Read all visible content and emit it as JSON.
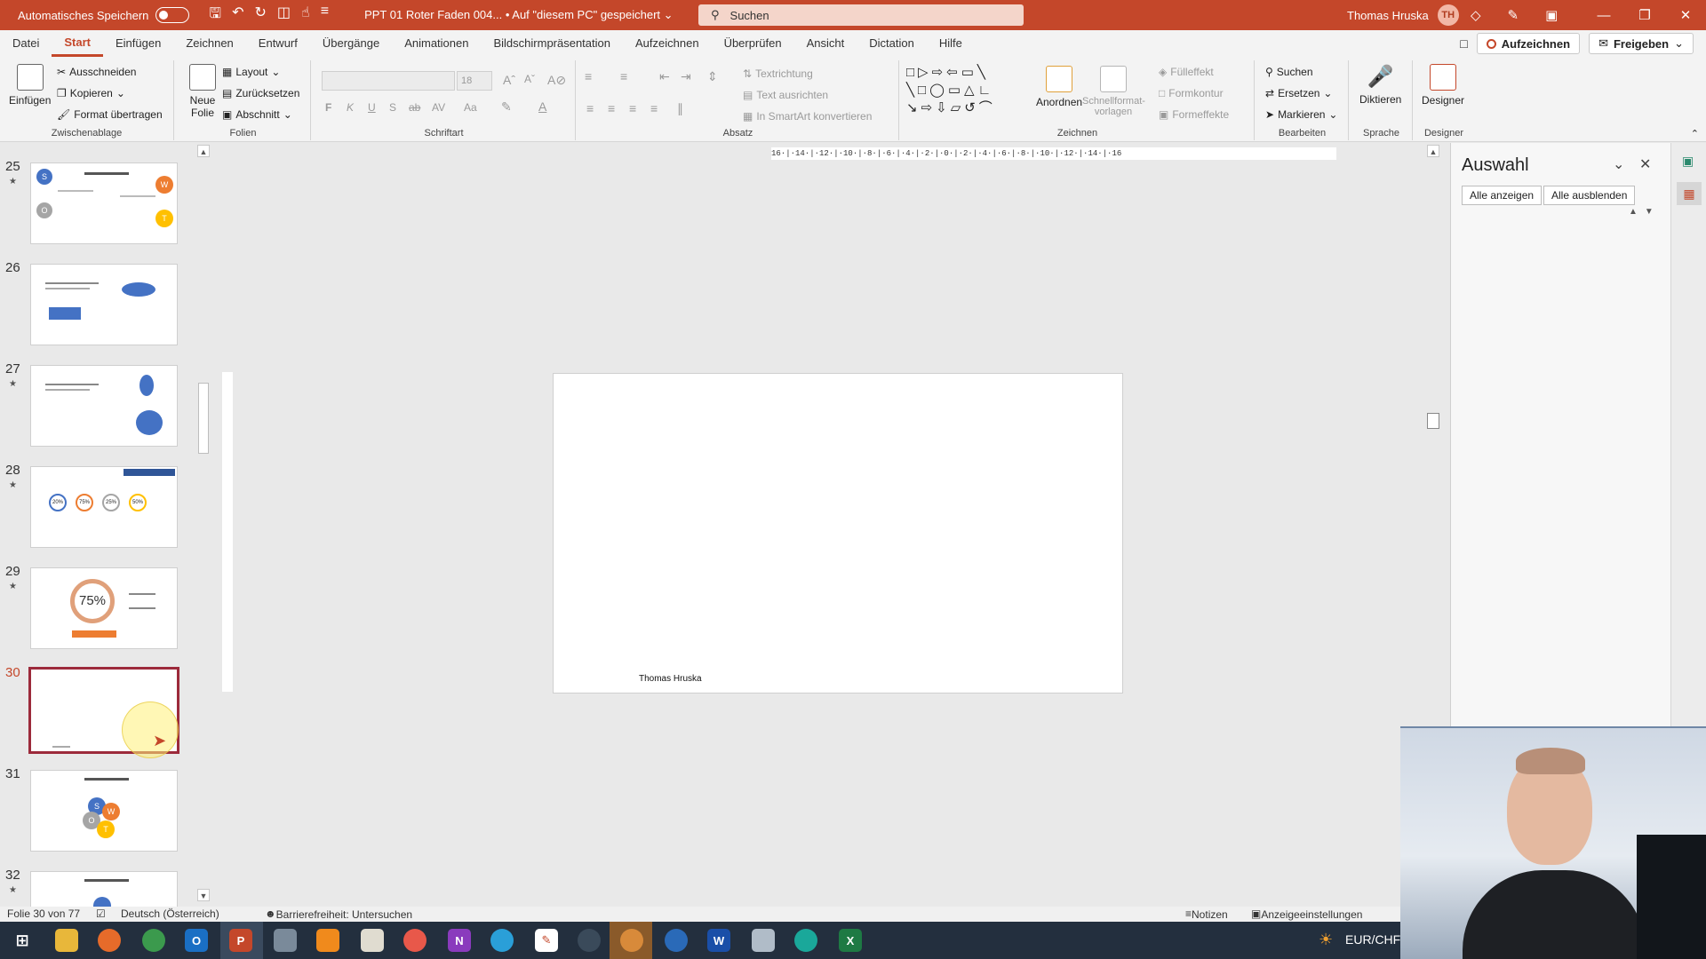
{
  "titlebar": {
    "autosave_label": "Automatisches Speichern",
    "doc_title": "PPT 01 Roter Faden 004...  •  Auf \"diesem PC\" gespeichert",
    "search_placeholder": "Suchen",
    "user_name": "Thomas Hruska",
    "user_initials": "TH"
  },
  "menu": {
    "tabs": [
      "Datei",
      "Start",
      "Einfügen",
      "Zeichnen",
      "Entwurf",
      "Übergänge",
      "Animationen",
      "Bildschirmpräsentation",
      "Aufzeichnen",
      "Überprüfen",
      "Ansicht",
      "Dictation",
      "Hilfe"
    ],
    "active_tab": "Start",
    "record_button": "Aufzeichnen",
    "share_button": "Freigeben"
  },
  "ribbon": {
    "clipboard": {
      "label": "Zwischenablage",
      "paste": "Einfügen",
      "cut": "Ausschneiden",
      "copy": "Kopieren",
      "format_painter": "Format übertragen"
    },
    "slides": {
      "label": "Folien",
      "new_slide": "Neue Folie",
      "layout": "Layout",
      "reset": "Zurücksetzen",
      "section": "Abschnitt"
    },
    "font": {
      "label": "Schriftart",
      "size": "18",
      "bold": "F",
      "italic": "K",
      "underline": "U",
      "shadow": "S",
      "strike": "ab",
      "spacing": "AV",
      "case": "Aa"
    },
    "paragraph": {
      "label": "Absatz",
      "text_direction": "Textrichtung",
      "align_text": "Text ausrichten",
      "smartart": "In SmartArt konvertieren"
    },
    "drawing": {
      "label": "Zeichnen",
      "arrange": "Anordnen",
      "quick_styles": "Schnellformat-vorlagen",
      "fill": "Fülleffekt",
      "outline": "Formkontur",
      "effects": "Formeffekte"
    },
    "editing": {
      "label": "Bearbeiten",
      "find": "Suchen",
      "replace": "Ersetzen",
      "select": "Markieren"
    },
    "voice": {
      "label": "Sprache",
      "dictate": "Diktieren"
    },
    "designer": {
      "label": "Designer",
      "designer": "Designer"
    }
  },
  "thumbnails": [
    {
      "number": "25",
      "starred": true
    },
    {
      "number": "26",
      "starred": false
    },
    {
      "number": "27",
      "starred": true
    },
    {
      "number": "28",
      "starred": true
    },
    {
      "number": "29",
      "starred": true,
      "text": "75%"
    },
    {
      "number": "30",
      "starred": false,
      "current": true
    },
    {
      "number": "31",
      "starred": false
    },
    {
      "number": "32",
      "starred": true
    }
  ],
  "thumb_labels": {
    "swot_s": "S",
    "swot_w": "W",
    "swot_o": "O",
    "swot_t": "T",
    "p20": "20%",
    "p75": "75%",
    "p25": "25%",
    "p50": "50%"
  },
  "ruler": {
    "horizontal": "16·|·14·|·12·|·10·|·8·|·6·|·4·|·2·|·0·|·2·|·4·|·6·|·8·|·10·|·12·|·14·|·16"
  },
  "slide": {
    "footer": "Thomas Hruska"
  },
  "selection_pane": {
    "title": "Auswahl",
    "show_all": "Alle anzeigen",
    "hide_all": "Alle ausblenden"
  },
  "status": {
    "slide_info": "Folie 30 von 77",
    "language": "Deutsch (Österreich)",
    "accessibility": "Barrierefreiheit: Untersuchen",
    "notes": "Notizen",
    "display_settings": "Anzeigeeinstellungen"
  },
  "taskbar": {
    "tray_text": "EUR/CHF"
  },
  "colors": {
    "accent": "#c4472a",
    "current_slide_border": "#9c2a3b",
    "shape_blue": "#4472c4"
  }
}
